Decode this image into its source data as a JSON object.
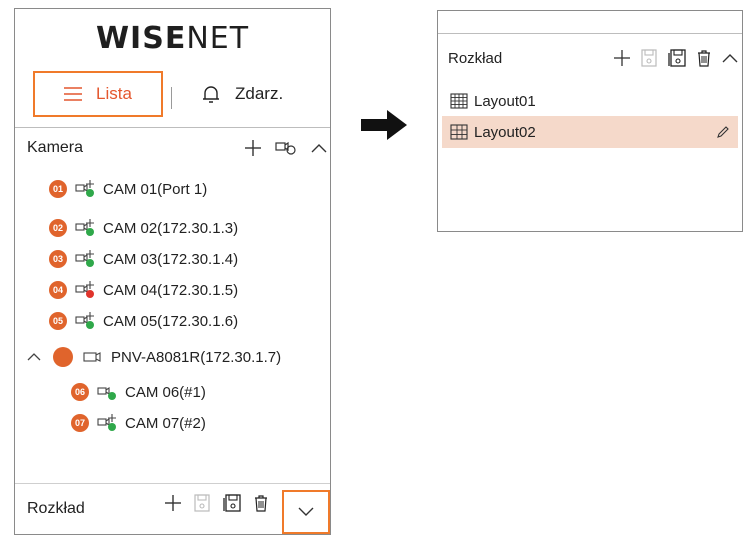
{
  "left_panel": {
    "logo_bold": "WISE",
    "logo_light": "NET",
    "tabs": {
      "lista_label": "Lista",
      "zdarz_label": "Zdarz."
    },
    "camera_section": {
      "title": "Kamera"
    },
    "cameras": [
      {
        "num": "01",
        "name": "CAM 01(Port 1)",
        "status": "green"
      },
      {
        "num": "02",
        "name": "CAM 02(172.30.1.3)",
        "status": "green"
      },
      {
        "num": "03",
        "name": "CAM 03(172.30.1.4)",
        "status": "green"
      },
      {
        "num": "04",
        "name": "CAM 04(172.30.1.5)",
        "status": "red"
      },
      {
        "num": "05",
        "name": "CAM 05(172.30.1.6)",
        "status": "green"
      }
    ],
    "nvr": {
      "name": "PNV-A8081R(172.30.1.7)"
    },
    "nvr_children": [
      {
        "num": "06",
        "name": "CAM 06(#1)",
        "status": "green"
      },
      {
        "num": "07",
        "name": "CAM 07(#2)",
        "status": "green"
      }
    ],
    "layout_section": {
      "title": "Rozkład"
    }
  },
  "right_panel": {
    "layout_section": {
      "title": "Rozkład"
    },
    "layouts": [
      {
        "name": "Layout01",
        "selected": false
      },
      {
        "name": "Layout02",
        "selected": true
      }
    ]
  },
  "colors": {
    "accent": "#f07a2a",
    "badge": "#e0642c",
    "selected_row": "#f5d9ca",
    "status_green": "#2fa84a",
    "status_red": "#e0342c"
  }
}
